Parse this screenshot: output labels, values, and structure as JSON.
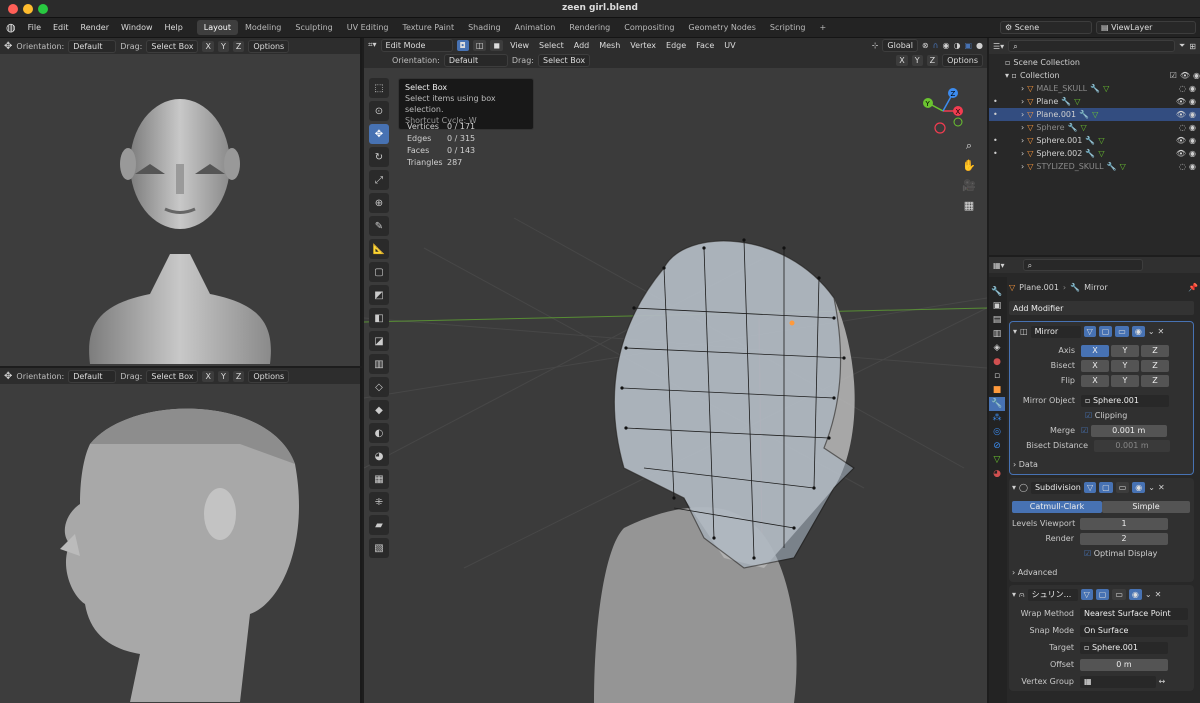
{
  "window": {
    "title": "zeen girl.blend"
  },
  "menu": [
    "File",
    "Edit",
    "Render",
    "Window",
    "Help"
  ],
  "workspaces": [
    "Layout",
    "Modeling",
    "Sculpting",
    "UV Editing",
    "Texture Paint",
    "Shading",
    "Animation",
    "Rendering",
    "Compositing",
    "Geometry Nodes",
    "Scripting"
  ],
  "active_workspace": "Layout",
  "scene": {
    "name": "Scene",
    "view_layer": "ViewLayer"
  },
  "left_top_header": {
    "orientation_label": "Orientation:",
    "orientation": "Default",
    "drag_label": "Drag:",
    "drag": "Select Box",
    "options": "Options"
  },
  "left_bottom_header": {
    "orientation_label": "Orientation:",
    "orientation": "Default",
    "drag_label": "Drag:",
    "drag": "Select Box",
    "options": "Options"
  },
  "axes": [
    "X",
    "Y",
    "Z"
  ],
  "main_header": {
    "mode": "Edit Mode",
    "menus": [
      "View",
      "Select",
      "Add",
      "Mesh",
      "Vertex",
      "Edge",
      "Face",
      "UV"
    ],
    "transform": "Global",
    "orientation_label": "Orientation:",
    "orientation": "Default",
    "drag_label": "Drag:",
    "drag": "Select Box",
    "options": "Options"
  },
  "tooltip": {
    "title": "Select Box",
    "desc": "Select items using box selection.",
    "shortcut": "Shortcut Cycle: W"
  },
  "stats": [
    {
      "label": "Vertices",
      "value": "0 / 171"
    },
    {
      "label": "Edges",
      "value": "0 / 315"
    },
    {
      "label": "Faces",
      "value": "0 / 143"
    },
    {
      "label": "Triangles",
      "value": "287"
    }
  ],
  "outliner": {
    "root": "Scene Collection",
    "collection": "Collection",
    "items": [
      {
        "name": "MALE_SKULL",
        "dim": true,
        "selected": false
      },
      {
        "name": "Plane",
        "dim": false,
        "selected": false
      },
      {
        "name": "Plane.001",
        "dim": false,
        "selected": true
      },
      {
        "name": "Sphere",
        "dim": true,
        "selected": false
      },
      {
        "name": "Sphere.001",
        "dim": false,
        "selected": false
      },
      {
        "name": "Sphere.002",
        "dim": false,
        "selected": false
      },
      {
        "name": "STYLIZED_SKULL",
        "dim": true,
        "selected": false
      }
    ]
  },
  "properties": {
    "object": "Plane.001",
    "modifier_tab": "Mirror",
    "add_modifier": "Add Modifier",
    "mirror": {
      "name": "Mirror",
      "axis_label": "Axis",
      "bisect_label": "Bisect",
      "flip_label": "Flip",
      "mirror_object_label": "Mirror Object",
      "mirror_object": "Sphere.001",
      "clipping": "Clipping",
      "merge_label": "Merge",
      "merge": "0.001 m",
      "bisect_distance_label": "Bisect Distance",
      "bisect_distance": "0.001 m",
      "data": "Data"
    },
    "subdivision": {
      "name": "Subdivision",
      "catmull": "Catmull-Clark",
      "simple": "Simple",
      "levels_label": "Levels Viewport",
      "levels": "1",
      "render_label": "Render",
      "render": "2",
      "optimal": "Optimal Display",
      "advanced": "Advanced"
    },
    "shrinkwrap": {
      "name": "シュリン...",
      "wrap_label": "Wrap Method",
      "wrap": "Nearest Surface Point",
      "snap_label": "Snap Mode",
      "snap": "On Surface",
      "target_label": "Target",
      "target": "Sphere.001",
      "offset_label": "Offset",
      "offset": "0 m",
      "vgroup_label": "Vertex Group"
    }
  },
  "colors": {
    "accent": "#4772b3",
    "x_axis": "#f23c50",
    "y_axis": "#6bc430",
    "z_axis": "#3c8cf0",
    "mesh_orange": "#ff9a3c"
  }
}
